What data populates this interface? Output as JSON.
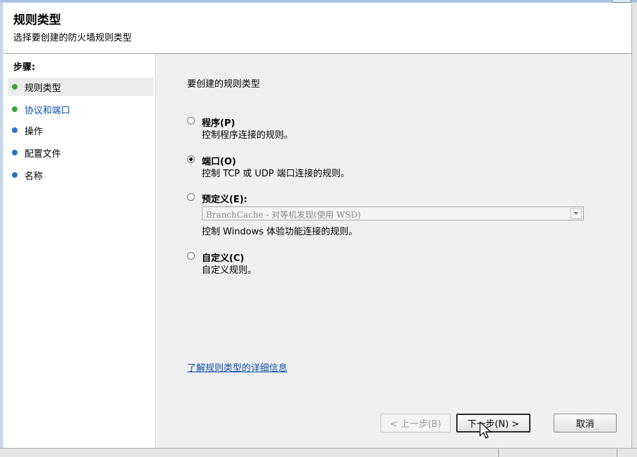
{
  "window": {
    "title": "规则类型",
    "subtitle": "选择要创建的防火墙规则类型"
  },
  "sidebar": {
    "heading": "步骤:",
    "steps": [
      {
        "label": "规则类型",
        "color": "#3aa53a"
      },
      {
        "label": "协议和端口",
        "color": "#3aa53a"
      },
      {
        "label": "操作",
        "color": "#2f6fc5"
      },
      {
        "label": "配置文件",
        "color": "#2f6fc5"
      },
      {
        "label": "名称",
        "color": "#2f6fc5"
      }
    ]
  },
  "main": {
    "prompt": "要创建的规则类型",
    "options": [
      {
        "title": "程序(P)",
        "desc": "控制程序连接的规则。",
        "checked": false
      },
      {
        "title": "端口(O)",
        "desc": "控制 TCP 或 UDP 端口连接的规则。",
        "checked": true
      },
      {
        "title": "预定义(E):",
        "desc": "",
        "checked": false
      },
      {
        "title": "自定义(C)",
        "desc": "自定义规则。",
        "checked": false
      }
    ],
    "predefined_combo": {
      "value": "BranchCache - 对等机发现(使用 WSD)",
      "desc": "控制 Windows 体验功能连接的规则。"
    },
    "learn_more": "了解规则类型的详细信息"
  },
  "buttons": {
    "back": "< 上一步(B)",
    "next": "下一步(N) >",
    "cancel": "取消"
  }
}
